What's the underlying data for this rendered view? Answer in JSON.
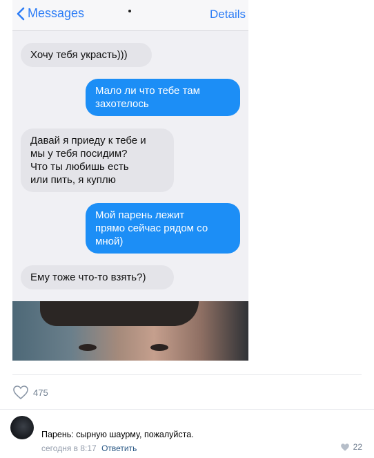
{
  "screenshot": {
    "nav": {
      "back_label": "Messages",
      "details_label": "Details"
    },
    "messages": [
      {
        "direction": "incoming",
        "text": "Хочу тебя украсть)))"
      },
      {
        "direction": "outgoing",
        "text": "Мало ли что тебе там\nзахотелось"
      },
      {
        "direction": "incoming",
        "text": "Давай я приеду к тебе и\nмы у тебя посидим?\nЧто ты любишь есть\nили пить, я куплю"
      },
      {
        "direction": "outgoing",
        "text": "Мой парень лежит\nпрямо сейчас рядом со\nмной)"
      },
      {
        "direction": "incoming",
        "text": "Ему тоже что-то взять?)"
      }
    ]
  },
  "post": {
    "likes_count": "475"
  },
  "comment": {
    "text": "Парень: сырную шаурму, пожалуйста.",
    "time": "сегодня в 8:17",
    "reply_label": "Ответить",
    "likes_count": "22"
  },
  "colors": {
    "accent": "#2b7cf6",
    "outgoing_bubble": "#1c8ef6",
    "incoming_bubble": "#e4e4e9",
    "meta_gray": "#939cab"
  }
}
